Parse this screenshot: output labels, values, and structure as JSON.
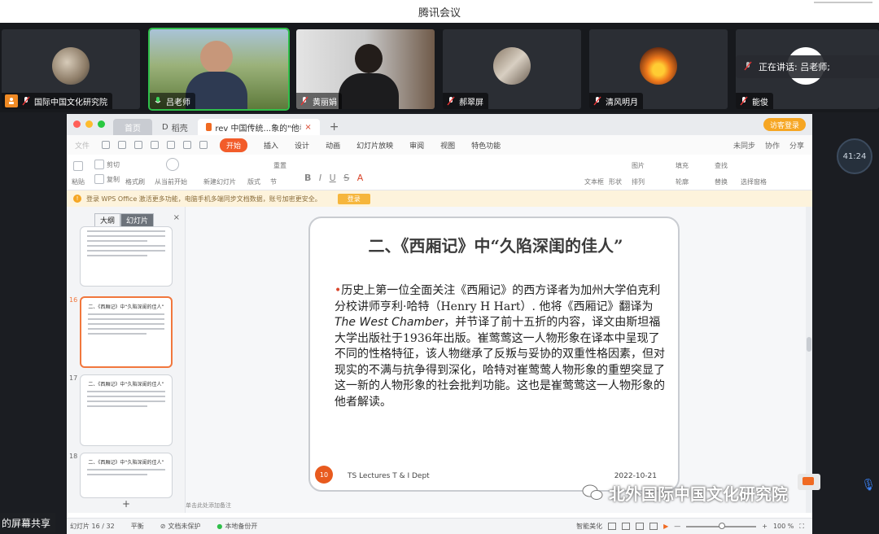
{
  "app": {
    "title": "腾讯会议"
  },
  "participants": [
    {
      "name": "国际中国文化研究院",
      "host": true
    },
    {
      "name": "吕老师",
      "active": true
    },
    {
      "name": "黄丽娟"
    },
    {
      "name": "郝翠屏"
    },
    {
      "name": "清风明月"
    },
    {
      "name": "能俊"
    }
  ],
  "speaking": "正在讲话: 吕老师;",
  "timer": "41:24",
  "browser": {
    "tabs": [
      {
        "label": "首页"
      },
      {
        "label": "稻壳"
      },
      {
        "label": "rev 中国传统...象的\"他者\"解读"
      }
    ],
    "login": "访客登录"
  },
  "menu": {
    "items": [
      "文件",
      "开始",
      "插入",
      "设计",
      "动画",
      "幻灯片放映",
      "审阅",
      "视图",
      "特色功能"
    ],
    "active": "开始",
    "right": [
      "未同步",
      "协作",
      "分享"
    ]
  },
  "ribbon": {
    "paste": "粘贴",
    "cut": "剪切",
    "copy": "复制",
    "format_painter": "格式刷",
    "play_from_current": "从当前开始",
    "new_slide": "新建幻灯片",
    "layout": "版式",
    "section": "节",
    "reset": "重置",
    "textbox": "文本框",
    "shape": "形状",
    "arrange": "排列",
    "outline": "轮廓",
    "picture": "图片",
    "fill": "填充",
    "find": "查找",
    "replace": "替换",
    "select_pane": "选择窗格"
  },
  "notice": {
    "text": "登录 WPS Office 激活更多功能，电脑手机多端同步文档数据，账号加密更安全。",
    "button": "登录"
  },
  "thumbs": {
    "tab_outline": "大纲",
    "tab_slides": "幻灯片",
    "close": "×",
    "items": [
      {
        "num": "",
        "title": ""
      },
      {
        "num": "16",
        "title": "二、《西厢记》中“久陷深闺的佳人”"
      },
      {
        "num": "17",
        "title": "二、《西厢记》中“久陷深闺的佳人”"
      },
      {
        "num": "18",
        "title": "二、《西厢记》中“久陷深闺的佳人”"
      }
    ],
    "add": "+"
  },
  "slide": {
    "title": "二、《西厢记》中“久陷深闺的佳人”",
    "bullet": "•",
    "p1": "历史上第一位全面关注《西厢记》的西方译者为加州大学伯克利分校讲师亨利·哈特（Henry H Hart）. 他将《西厢记》翻译为",
    "p_italic": "The West Chamber",
    "p2": "，并节译了前十五折的内容，译文由斯坦福大学出版社于1936年出版。崔莺莺这一人物形象在译本中呈现了不同的性格特征，该人物继承了反叛与妥协的双重性格因素，但对现实的不满与抗争得到深化，哈特对崔莺莺人物形象的重塑突显了这一新的人物形象的社会批判功能。这也是崔莺莺这一人物形象的他者解读。",
    "num": "10",
    "footer": "TS Lectures  T & I Dept",
    "date": "2022-10-21"
  },
  "notes_placeholder": "单击此处添加备注",
  "status": {
    "slide": "幻灯片 16 / 32",
    "theme": "平衡",
    "protect": "文档未保护",
    "backup": "本地备份开",
    "beautify": "智能美化",
    "zoom": "100 %"
  },
  "overlay": {
    "screen_share": "的屏幕共享",
    "watermark": "北外国际中国文化研究院"
  }
}
